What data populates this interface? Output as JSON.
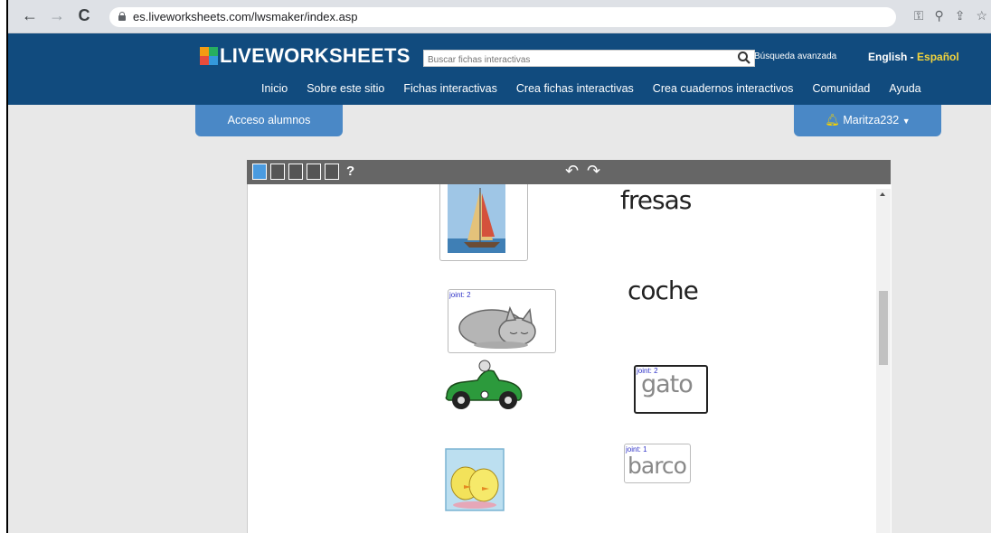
{
  "browser": {
    "url": "es.liveworksheets.com/lwsmaker/index.asp"
  },
  "site": {
    "logo_prefix": "",
    "logo_text": "LIVEWORKSHEETS",
    "search_placeholder": "Buscar fichas interactivas",
    "advanced_search": "Búsqueda avanzada",
    "lang_en": "English",
    "lang_sep": " - ",
    "lang_es": "Español",
    "menu": [
      "Inicio",
      "Sobre este sitio",
      "Fichas interactivas",
      "Crea fichas interactivas",
      "Crea cuadernos interactivos",
      "Comunidad",
      "Ayuda"
    ],
    "students_access": "Acceso alumnos",
    "user": "Maritza232"
  },
  "editor": {
    "toolbar_help": "?",
    "words": {
      "w1": "fresas",
      "w2": "coche",
      "w3": "gato",
      "w4": "barco"
    },
    "joints": {
      "j_cat": "joint: 2",
      "j_gato": "joint: 2",
      "j_barco": "joint: 1"
    }
  }
}
